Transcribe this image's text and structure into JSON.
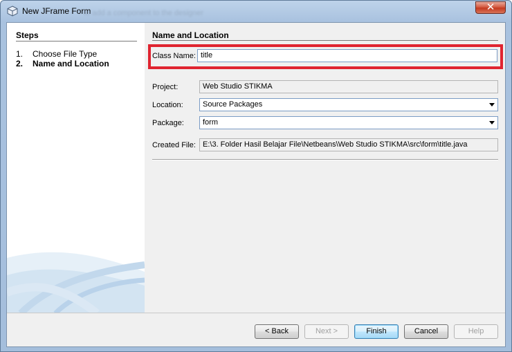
{
  "window": {
    "title": "New JFrame Form",
    "ghost_title": "to add a component to the designer"
  },
  "steps": {
    "heading": "Steps",
    "items": [
      {
        "num": "1.",
        "label": "Choose File Type"
      },
      {
        "num": "2.",
        "label": "Name and Location"
      }
    ]
  },
  "form": {
    "heading": "Name and Location",
    "class_name_label": "Class Name:",
    "class_name_value": "title",
    "project_label": "Project:",
    "project_value": "Web Studio STIKMA",
    "location_label": "Location:",
    "location_value": "Source Packages",
    "package_label": "Package:",
    "package_value": "form",
    "created_file_label": "Created File:",
    "created_file_value": "E:\\3. Folder Hasil Belajar File\\Netbeans\\Web Studio STIKMA\\src\\form\\title.java"
  },
  "buttons": {
    "back": "< Back",
    "next": "Next >",
    "finish": "Finish",
    "cancel": "Cancel",
    "help": "Help"
  },
  "colors": {
    "highlight": "#e02430",
    "title_gradient": "#a9c2df"
  }
}
